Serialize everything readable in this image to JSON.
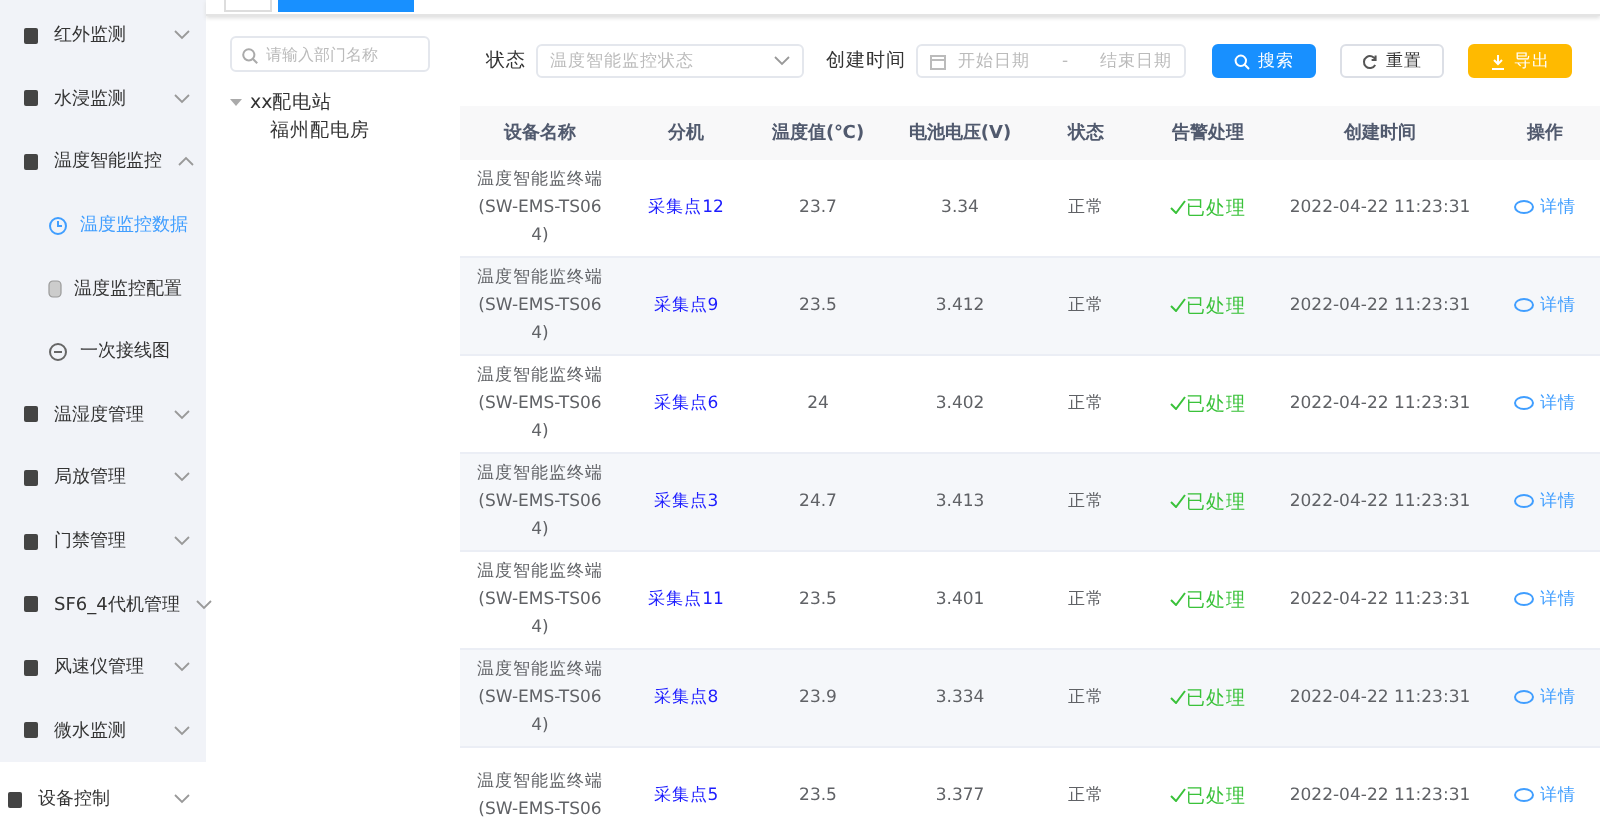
{
  "tabs": [
    {
      "selected": false
    },
    {
      "selected": true
    }
  ],
  "sidebar": {
    "items": [
      {
        "label": "红外监测",
        "expanded": false
      },
      {
        "label": "水浸监测",
        "expanded": false
      },
      {
        "label": "温度智能监控",
        "expanded": true,
        "children": [
          {
            "label": "温度监控数据",
            "selected": true
          },
          {
            "label": "温度监控配置",
            "selected": false
          },
          {
            "label": "一次接线图",
            "selected": false
          }
        ]
      },
      {
        "label": "温湿度管理",
        "expanded": false
      },
      {
        "label": "局放管理",
        "expanded": false
      },
      {
        "label": "门禁管理",
        "expanded": false
      },
      {
        "label": "SF6_4代机管理",
        "expanded": false
      },
      {
        "label": "风速仪管理",
        "expanded": false
      },
      {
        "label": "微水监测",
        "expanded": false
      }
    ],
    "footer_item": {
      "label": "设备控制",
      "expanded": false
    }
  },
  "tree": {
    "search": {
      "placeholder": "请输入部门名称"
    },
    "nodes": [
      {
        "label": "xx配电站",
        "expanded": true,
        "children": [
          {
            "label": "福州配电房"
          }
        ]
      }
    ]
  },
  "filters": {
    "status_label": "状态",
    "status_placeholder": "温度智能监控状态",
    "date_label": "创建时间",
    "start_placeholder": "开始日期",
    "separator": "-",
    "end_placeholder": "结束日期"
  },
  "buttons": [
    {
      "label": "搜索",
      "kind": "primary"
    },
    {
      "label": "重置",
      "kind": "default"
    },
    {
      "label": "导出",
      "kind": "warning"
    }
  ],
  "table": {
    "columns": [
      "设备名称",
      "分机",
      "温度值(℃)",
      "电池电压(V)",
      "状态",
      "告警处理",
      "创建时间",
      "操作"
    ],
    "rows": [
      {
        "name": "温度智能监终端(SW-EMS-TS064)",
        "point": "采集点12",
        "temp": "23.7",
        "voltage": "3.34",
        "status": "正常",
        "alarm": "已处理",
        "created": "2022-04-22 11:23:31",
        "action": "详情"
      },
      {
        "name": "温度智能监终端(SW-EMS-TS064)",
        "point": "采集点9",
        "temp": "23.5",
        "voltage": "3.412",
        "status": "正常",
        "alarm": "已处理",
        "created": "2022-04-22 11:23:31",
        "action": "详情"
      },
      {
        "name": "温度智能监终端(SW-EMS-TS064)",
        "point": "采集点6",
        "temp": "24",
        "voltage": "3.402",
        "status": "正常",
        "alarm": "已处理",
        "created": "2022-04-22 11:23:31",
        "action": "详情"
      },
      {
        "name": "温度智能监终端(SW-EMS-TS064)",
        "point": "采集点3",
        "temp": "24.7",
        "voltage": "3.413",
        "status": "正常",
        "alarm": "已处理",
        "created": "2022-04-22 11:23:31",
        "action": "详情"
      },
      {
        "name": "温度智能监终端(SW-EMS-TS064)",
        "point": "采集点11",
        "temp": "23.5",
        "voltage": "3.401",
        "status": "正常",
        "alarm": "已处理",
        "created": "2022-04-22 11:23:31",
        "action": "详情"
      },
      {
        "name": "温度智能监终端(SW-EMS-TS064)",
        "point": "采集点8",
        "temp": "23.9",
        "voltage": "3.334",
        "status": "正常",
        "alarm": "已处理",
        "created": "2022-04-22 11:23:31",
        "action": "详情"
      },
      {
        "name": "温度智能监终端(SW-EMS-TS06",
        "point": "采集点5",
        "temp": "23.5",
        "voltage": "3.377",
        "status": "正常",
        "alarm": "已处理",
        "created": "2022-04-22 11:23:31",
        "action": "详情"
      }
    ]
  }
}
